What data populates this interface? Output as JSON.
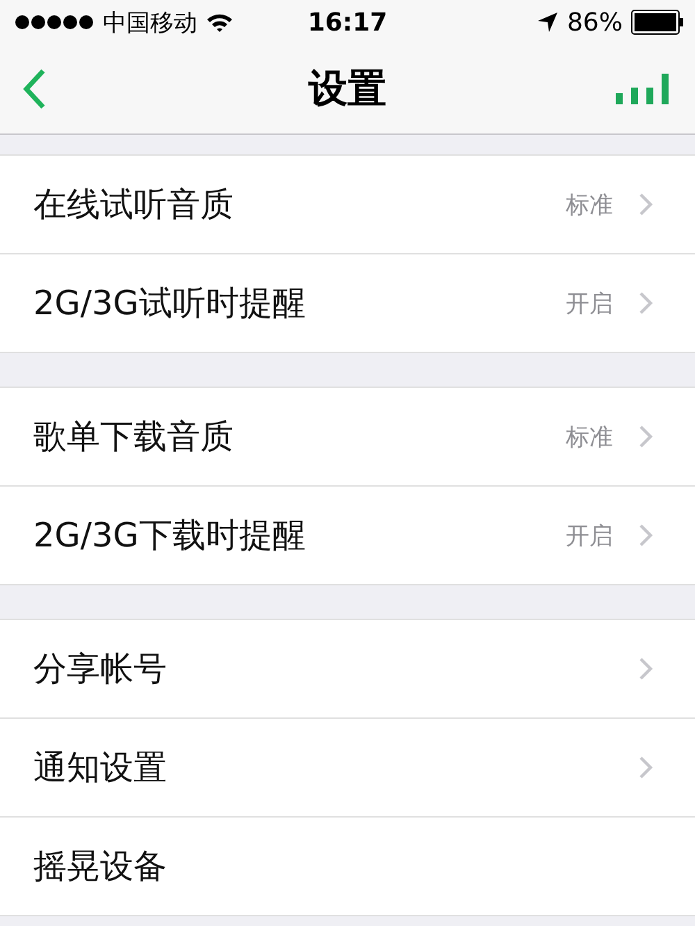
{
  "status_bar": {
    "carrier": "中国移动",
    "time": "16:17",
    "battery": "86%"
  },
  "nav": {
    "title": "设置"
  },
  "groups": [
    {
      "rows": [
        {
          "label": "在线试听音质",
          "value": "标准",
          "chevron": true
        },
        {
          "label": "2G/3G试听时提醒",
          "value": "开启",
          "chevron": true
        }
      ]
    },
    {
      "rows": [
        {
          "label": "歌单下载音质",
          "value": "标准",
          "chevron": true
        },
        {
          "label": "2G/3G下载时提醒",
          "value": "开启",
          "chevron": true
        }
      ]
    },
    {
      "rows": [
        {
          "label": "分享帐号",
          "chevron": true
        },
        {
          "label": "通知设置",
          "chevron": true
        },
        {
          "label": "摇晃设备",
          "chevron": false
        }
      ]
    }
  ]
}
